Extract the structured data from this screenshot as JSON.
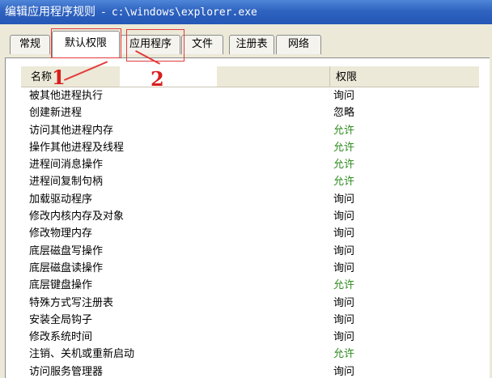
{
  "window": {
    "title": "编辑应用程序规则",
    "separator": "-",
    "path": "c:\\windows\\explorer.exe"
  },
  "tabs": [
    {
      "label": "常规",
      "active": false
    },
    {
      "label": "默认权限",
      "active": true
    },
    {
      "label": "应用程序",
      "active": false
    },
    {
      "label": "文件",
      "active": false
    },
    {
      "label": "注册表",
      "active": false
    },
    {
      "label": "网络",
      "active": false
    }
  ],
  "list": {
    "columns": {
      "name": "名称",
      "permission": "权限"
    },
    "rows": [
      {
        "name": "被其他进程执行",
        "permission": "询问",
        "allowed": false
      },
      {
        "name": "创建新进程",
        "permission": "忽略",
        "allowed": false
      },
      {
        "name": "访问其他进程内存",
        "permission": "允许",
        "allowed": true
      },
      {
        "name": "操作其他进程及线程",
        "permission": "允许",
        "allowed": true
      },
      {
        "name": "进程间消息操作",
        "permission": "允许",
        "allowed": true
      },
      {
        "name": "进程间复制句柄",
        "permission": "允许",
        "allowed": true
      },
      {
        "name": "加载驱动程序",
        "permission": "询问",
        "allowed": false
      },
      {
        "name": "修改内核内存及对象",
        "permission": "询问",
        "allowed": false
      },
      {
        "name": "修改物理内存",
        "permission": "询问",
        "allowed": false
      },
      {
        "name": "底层磁盘写操作",
        "permission": "询问",
        "allowed": false
      },
      {
        "name": "底层磁盘读操作",
        "permission": "询问",
        "allowed": false
      },
      {
        "name": "底层键盘操作",
        "permission": "允许",
        "allowed": true
      },
      {
        "name": "特殊方式写注册表",
        "permission": "询问",
        "allowed": false
      },
      {
        "name": "安装全局钩子",
        "permission": "询问",
        "allowed": false
      },
      {
        "name": "修改系统时间",
        "permission": "询问",
        "allowed": false
      },
      {
        "name": "注销、关机或重新启动",
        "permission": "允许",
        "allowed": true
      },
      {
        "name": "访问服务管理器",
        "permission": "询问",
        "allowed": false
      }
    ]
  },
  "annotations": [
    {
      "number": "1"
    },
    {
      "number": "2"
    }
  ],
  "colors": {
    "title_bar": "#2f63c0",
    "allow_text": "#2e8b1e",
    "annotation": "#e23b3b"
  }
}
